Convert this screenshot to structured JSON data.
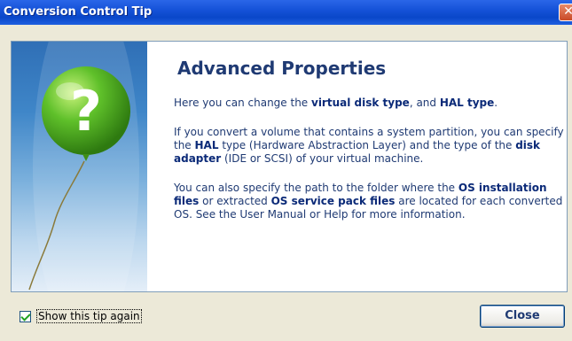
{
  "window": {
    "title": "Conversion Control Tip",
    "close_glyph": "✕"
  },
  "tip": {
    "heading": "Advanced Properties",
    "p1": {
      "t1": "Here you can change the ",
      "b1": "virtual disk type",
      "t2": ", and ",
      "b2": "HAL type",
      "t3": "."
    },
    "p2": {
      "t1": "If you convert a volume that contains a system partition, you can specify the ",
      "b1": "HAL",
      "t2": " type (Hardware Abstraction Layer) and the type of the ",
      "b2": "disk adapter",
      "t3": " (IDE or SCSI) of your virtual machine."
    },
    "p3": {
      "t1": "You can also specify the path to the folder where the ",
      "b1": "OS installation files",
      "t2": " or extracted ",
      "b2": "OS service pack files",
      "t3": " are located for each converted OS. See the User Manual or Help for more information."
    }
  },
  "footer": {
    "checkbox_label": "Show this tip again",
    "checkbox_checked": true,
    "close_label": "Close"
  },
  "icons": {
    "balloon": "question-balloon-icon",
    "check": "check-icon"
  },
  "colors": {
    "titlebar": "#0a47c9",
    "heading": "#1f3a73",
    "balloon": "#5fc02a"
  }
}
